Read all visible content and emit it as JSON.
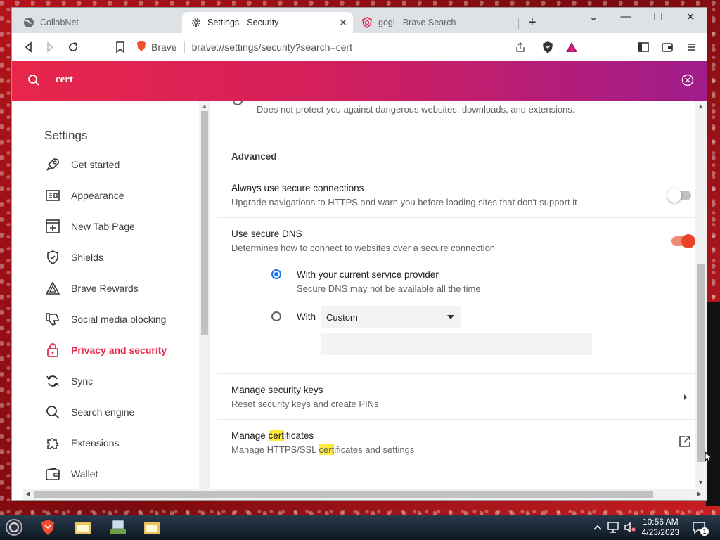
{
  "tabs": [
    {
      "label": "CollabNet",
      "active": false
    },
    {
      "label": "Settings - Security",
      "active": true
    },
    {
      "label": "gogl - Brave Search",
      "active": false
    }
  ],
  "toolbar": {
    "brand_label": "Brave",
    "url": "brave://settings/security?search=cert"
  },
  "search": {
    "query": "cert",
    "accent_start": "#e8264a",
    "accent_end": "#a01c8c"
  },
  "sidebar": {
    "title": "Settings",
    "items": [
      {
        "label": "Get started",
        "icon": "rocket-icon"
      },
      {
        "label": "Appearance",
        "icon": "appearance-icon"
      },
      {
        "label": "New Tab Page",
        "icon": "new-tab-icon"
      },
      {
        "label": "Shields",
        "icon": "shield-icon"
      },
      {
        "label": "Brave Rewards",
        "icon": "rewards-triangle-icon"
      },
      {
        "label": "Social media blocking",
        "icon": "thumbs-down-icon"
      },
      {
        "label": "Privacy and security",
        "icon": "lock-icon",
        "active": true
      },
      {
        "label": "Sync",
        "icon": "sync-icon"
      },
      {
        "label": "Search engine",
        "icon": "search-icon"
      },
      {
        "label": "Extensions",
        "icon": "puzzle-icon"
      },
      {
        "label": "Wallet",
        "icon": "wallet-icon"
      }
    ]
  },
  "content": {
    "top_partial_sub": "Does not protect you against dangerous websites, downloads, and extensions.",
    "advanced_heading": "Advanced",
    "secure_connections": {
      "title": "Always use secure connections",
      "subtitle": "Upgrade navigations to HTTPS and warn you before loading sites that don't support it",
      "enabled": false
    },
    "secure_dns": {
      "title": "Use secure DNS",
      "subtitle": "Determines how to connect to websites over a secure connection",
      "enabled": true,
      "option_current_label": "With your current service provider",
      "option_current_sub": "Secure DNS may not be available all the time",
      "option_with_label": "With",
      "select_value": "Custom",
      "selected_option": "current"
    },
    "security_keys": {
      "title": "Manage security keys",
      "subtitle": "Reset security keys and create PINs"
    },
    "certificates": {
      "title_pre": "Manage ",
      "title_hl": "cert",
      "title_post": "ificates",
      "sub_pre": "Manage HTTPS/SSL ",
      "sub_hl": "cert",
      "sub_post": "ificates and settings"
    }
  },
  "taskbar": {
    "time": "10:56 AM",
    "date": "4/23/2023",
    "notification_count": "1"
  },
  "colors": {
    "accent": "#e8264a",
    "radio_selected": "#1a73e8",
    "toggle_on": "#e8442a",
    "highlight": "#ffeb3b"
  }
}
